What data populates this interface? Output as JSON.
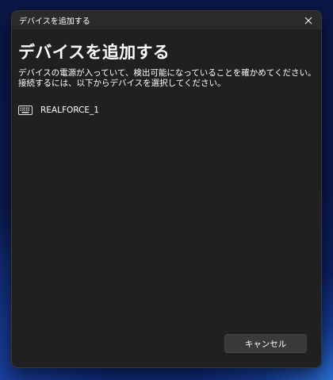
{
  "window": {
    "title": "デバイスを追加する"
  },
  "dialog": {
    "heading": "デバイスを追加する",
    "instruction": "デバイスの電源が入っていて、検出可能になっていることを確かめてください。接続するには、以下からデバイスを選択してください。"
  },
  "devices": [
    {
      "name": "REALFORCE_1",
      "icon": "keyboard-icon"
    }
  ],
  "footer": {
    "cancel_label": "キャンセル"
  },
  "colors": {
    "dialog_bg": "#202020",
    "titlebar_bg": "#2b2b2b",
    "button_bg": "#3a3a3a",
    "text": "#ffffff"
  }
}
